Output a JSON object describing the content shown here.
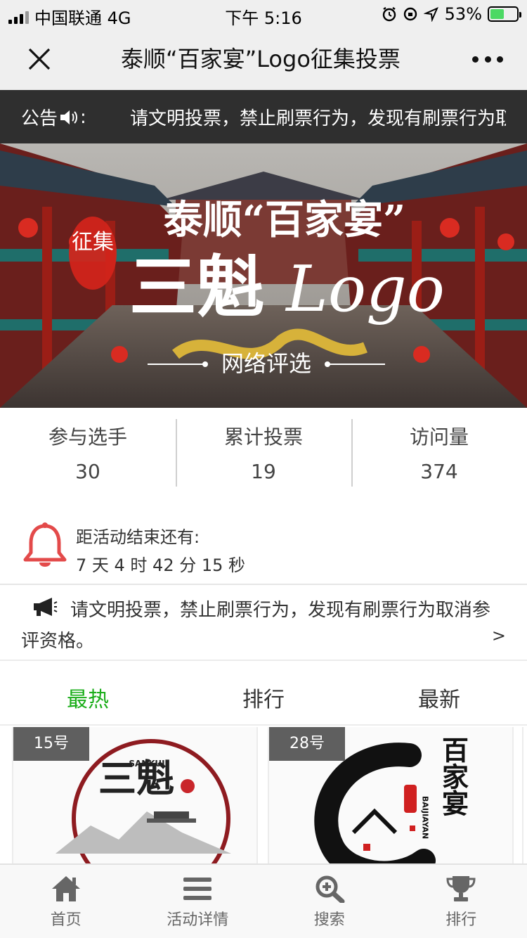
{
  "status_bar": {
    "carrier": "中国联通 4G",
    "time": "下午 5:16",
    "battery": "53%",
    "battery_level": 0.53
  },
  "title_bar": {
    "title": "泰顺“百家宴”Logo征集投票",
    "close_icon": "close-icon",
    "more_icon": "more-icon"
  },
  "notice_bar": {
    "label": "公告",
    "label_suffix": ":",
    "text": "请文明投票，禁止刷票行为，发现有刷票行为取消参评资格。"
  },
  "banner": {
    "badge": "征集",
    "line1": "泰顺“百家宴”",
    "line2_cn": "三魁",
    "line2_en": "Logo",
    "line3": "网络评选"
  },
  "stats": [
    {
      "label": "参与选手",
      "value": "30"
    },
    {
      "label": "累计投票",
      "value": "19"
    },
    {
      "label": "访问量",
      "value": "374"
    }
  ],
  "countdown": {
    "title": "距活动结束还有:",
    "remaining": "7 天 4 时 42 分 15 秒"
  },
  "rules": {
    "text": "请文明投票，禁止刷票行为，发现有刷票行为取消参评资格。",
    "arrow": ">"
  },
  "tabs": [
    {
      "label": "最热",
      "active": true
    },
    {
      "label": "排行",
      "active": false
    },
    {
      "label": "最新",
      "active": false
    }
  ],
  "entries": [
    {
      "number": "15号",
      "logo_text": "三魁",
      "logo_en": "SANKUI"
    },
    {
      "number": "28号",
      "logo_text": "百家宴",
      "logo_en": "BAIJIAYAN"
    }
  ],
  "bottom_nav": [
    {
      "label": "首页",
      "icon": "home-icon"
    },
    {
      "label": "活动详情",
      "icon": "list-icon"
    },
    {
      "label": "搜索",
      "icon": "search-icon"
    },
    {
      "label": "排行",
      "icon": "trophy-icon"
    }
  ],
  "colors": {
    "accent": "#1aad19",
    "notice_bg": "#2f2f2f",
    "bell": "#e34a4a"
  }
}
